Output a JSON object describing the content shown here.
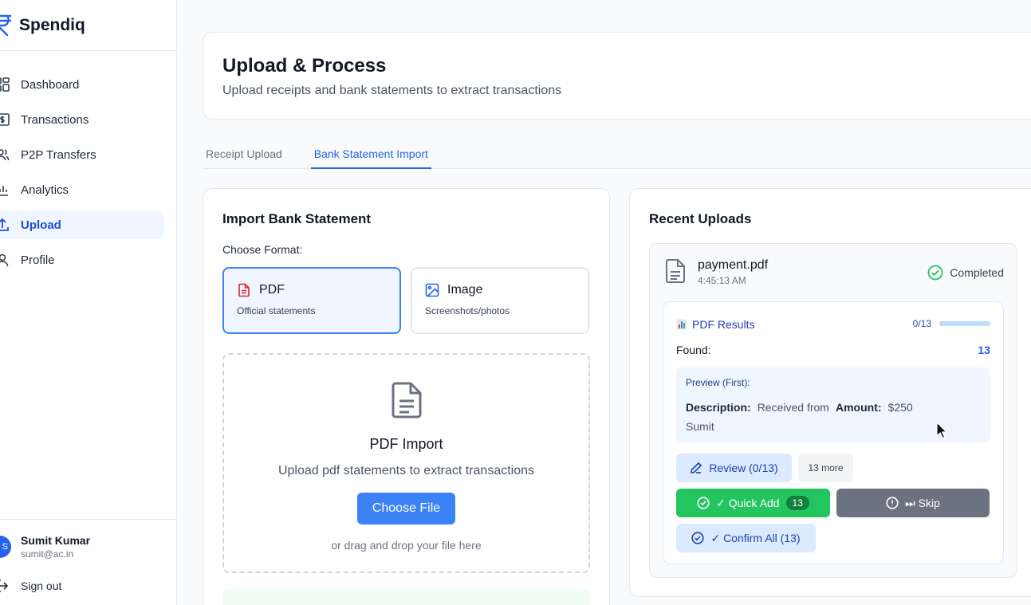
{
  "app": {
    "name": "Spendiq",
    "logo_icon": "rupee-icon",
    "accent": "#2563eb"
  },
  "sidebar": {
    "items": [
      {
        "label": "Dashboard",
        "icon": "dashboard-icon"
      },
      {
        "label": "Transactions",
        "icon": "transactions-icon"
      },
      {
        "label": "P2P Transfers",
        "icon": "users-icon"
      },
      {
        "label": "Analytics",
        "icon": "bar-chart-icon"
      },
      {
        "label": "Upload",
        "icon": "upload-icon",
        "active": true
      },
      {
        "label": "Profile",
        "icon": "user-icon"
      }
    ],
    "user": {
      "avatar_letter": "S",
      "name": "Sumit Kumar",
      "email": "sumit@ac.in"
    },
    "signout_label": "Sign out"
  },
  "header": {
    "title": "Upload & Process",
    "subtitle": "Upload receipts and bank statements to extract transactions"
  },
  "tabs": [
    {
      "label": "Receipt Upload",
      "active": false
    },
    {
      "label": "Bank Statement Import",
      "active": true
    }
  ],
  "import": {
    "title": "Import Bank Statement",
    "choose_format_label": "Choose Format:",
    "formats": [
      {
        "name": "PDF",
        "desc": "Official statements",
        "selected": true
      },
      {
        "name": "Image",
        "desc": "Screenshots/photos",
        "selected": false
      }
    ],
    "dropzone": {
      "title": "PDF Import",
      "subtitle": "Upload pdf statements to extract transactions",
      "button_label": "Choose File",
      "hint": "or drag and drop your file here"
    }
  },
  "recent": {
    "title": "Recent Uploads",
    "item": {
      "file_name": "payment.pdf",
      "time": "4:45:13 AM",
      "status": "Completed",
      "results": {
        "title": "PDF Results",
        "progress_text": "0/13",
        "progress_fraction": 0,
        "found_label": "Found:",
        "found_value": "13",
        "preview_title": "Preview (First):",
        "description_label": "Description:",
        "description_value": "Received from Sumit",
        "amount_label": "Amount:",
        "amount_value": "$250"
      },
      "buttons": {
        "review": "Review (0/13)",
        "more": "13 more",
        "quick_add": "✓ Quick Add",
        "quick_add_count": "13",
        "skip": "⏭ Skip",
        "confirm_all": "✓ Confirm All (13)"
      }
    }
  }
}
